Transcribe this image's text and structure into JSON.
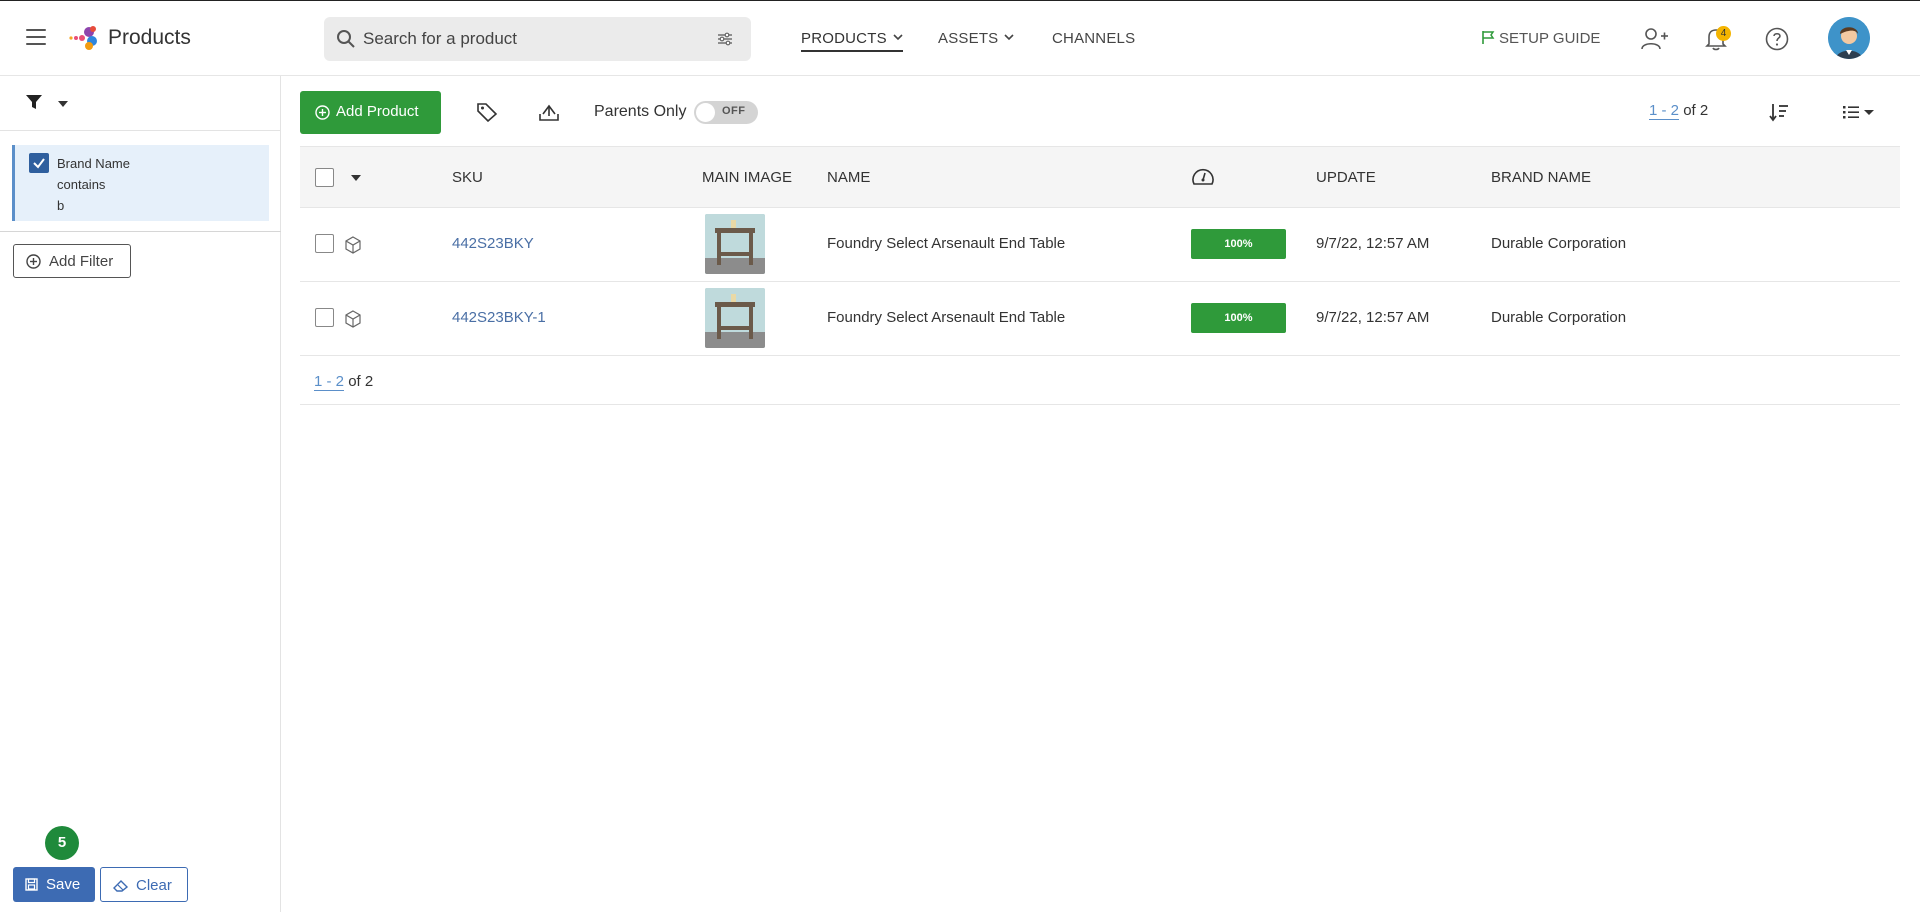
{
  "app": {
    "title": "Products"
  },
  "search": {
    "placeholder": "Search for a product"
  },
  "nav": [
    {
      "label": "PRODUCTS",
      "active": true,
      "has_menu": true
    },
    {
      "label": "ASSETS",
      "active": false,
      "has_menu": true
    },
    {
      "label": "CHANNELS",
      "active": false,
      "has_menu": false
    }
  ],
  "header": {
    "setup_guide": "SETUP GUIDE",
    "notification_count": "4",
    "icons": [
      "menu-icon",
      "search-icon",
      "sliders-icon",
      "flag-icon",
      "add-user-icon",
      "bell-icon",
      "help-icon",
      "avatar"
    ]
  },
  "sidebar": {
    "filter": {
      "field": "Brand Name",
      "operator": "contains",
      "value": "b",
      "checked": true
    },
    "add_filter_label": "Add Filter",
    "step_badge": "5",
    "save_label": "Save",
    "clear_label": "Clear"
  },
  "toolbar": {
    "add_product_label": "Add Product",
    "parents_only_label": "Parents Only",
    "parents_only_state": "OFF"
  },
  "pagination": {
    "range": "1 - 2",
    "of_text": "of 2"
  },
  "table": {
    "columns": [
      "SKU",
      "MAIN IMAGE",
      "NAME",
      "UPDATE",
      "BRAND NAME"
    ],
    "rows": [
      {
        "sku": "442S23BKY",
        "name": "Foundry Select Arsenault End Table",
        "score": "100%",
        "update": "9/7/22, 12:57 AM",
        "brand": "Durable Corporation"
      },
      {
        "sku": "442S23BKY-1",
        "name": "Foundry Select Arsenault End Table",
        "score": "100%",
        "update": "9/7/22, 12:57 AM",
        "brand": "Durable Corporation"
      }
    ]
  },
  "colors": {
    "primary_green": "#2f9a3a",
    "accent_blue": "#3d6bb3",
    "link_blue": "#4a6fa5",
    "badge_yellow": "#f4b400"
  }
}
